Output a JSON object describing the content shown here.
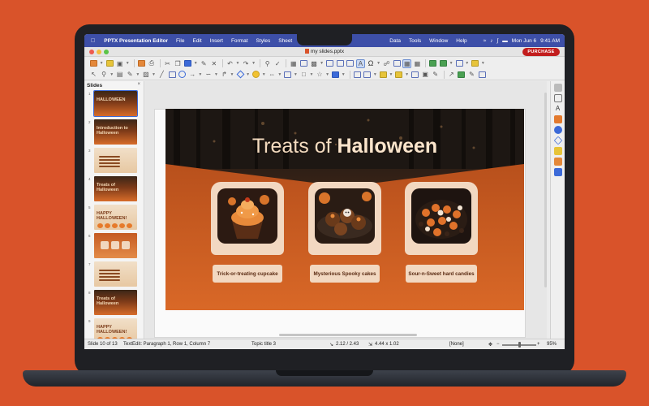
{
  "menubar": {
    "app_name": "PPTX Presentation Editor",
    "items": [
      "File",
      "Edit",
      "Insert",
      "Format",
      "Styles",
      "Sheet",
      "Data",
      "Tools",
      "Window",
      "Help"
    ],
    "date": "Mon Jun 6",
    "time": "9:41 AM"
  },
  "window": {
    "title": "my slides.pptx",
    "purchase_label": "PURCHASE"
  },
  "slides_panel": {
    "title": "Slides",
    "close": "×",
    "thumbnails": [
      {
        "num": "1",
        "text": "HALLOWEEN",
        "style": "dark"
      },
      {
        "num": "2",
        "text": "Introduction to Halloween",
        "style": "dark"
      },
      {
        "num": "3",
        "text": "",
        "style": "light"
      },
      {
        "num": "4",
        "text": "Treats of Halloween",
        "style": "dark"
      },
      {
        "num": "5",
        "text": "HAPPY HALLOWEEN!",
        "style": "light"
      },
      {
        "num": "6",
        "text": "",
        "style": "orange"
      },
      {
        "num": "7",
        "text": "",
        "style": "light"
      },
      {
        "num": "8",
        "text": "Treats of Halloween",
        "style": "dark"
      },
      {
        "num": "9",
        "text": "HAPPY HALLOWEEN!",
        "style": "light"
      }
    ]
  },
  "slide": {
    "title_normal": "Treats of ",
    "title_bold": "Halloween",
    "cards": [
      {
        "caption": "Trick-or-treating cupcake"
      },
      {
        "caption": "Mysterious Spooky cakes"
      },
      {
        "caption": "Sour-n-Sweet hard candies"
      }
    ]
  },
  "statusbar": {
    "slide_info": "Slide 10 of 13",
    "text_edit": "TextEdit: Paragraph 1, Row 1, Column 7",
    "layout": "Topic title 3",
    "position": "2.12 / 2.43",
    "size": "4.44 x 1.02",
    "language": "[None]",
    "zoom": "95%"
  },
  "colors": {
    "background": "#d9532a",
    "menubar": "#3d4fa8",
    "purchase": "#c21d1d",
    "card": "#f2d8c1"
  }
}
